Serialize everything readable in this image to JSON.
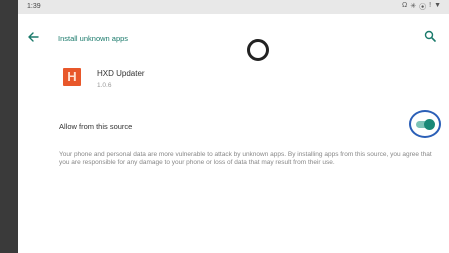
{
  "status_bar": {
    "time": "1:39",
    "icons": [
      "Ω",
      "✳",
      "⦿",
      "!",
      "▼"
    ]
  },
  "app_bar": {
    "title": "Install unknown apps",
    "accent_color": "#1a7a6b"
  },
  "app": {
    "name": "HXD Updater",
    "version": "1.0.6",
    "icon_letter": "H",
    "icon_color": "#e8572a"
  },
  "setting": {
    "label": "Allow from this source",
    "enabled": true
  },
  "description": "Your phone and personal data are more vulnerable to attack by unknown apps. By installing apps from this source, you agree that you are responsible for any damage to your phone or loss of data that may result from their use."
}
